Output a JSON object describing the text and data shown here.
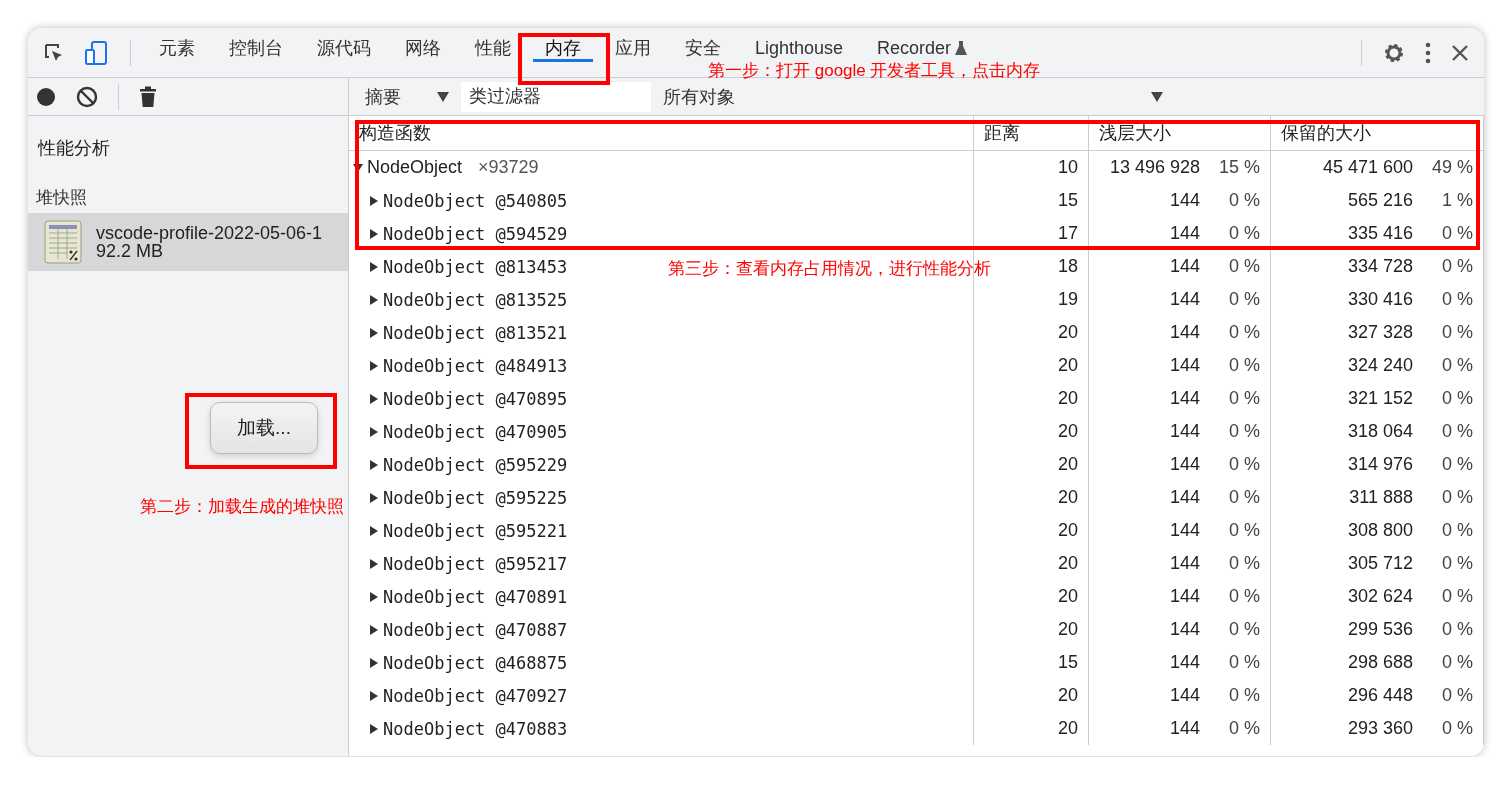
{
  "tabs": [
    {
      "label": "元素",
      "selected": false
    },
    {
      "label": "控制台",
      "selected": false
    },
    {
      "label": "源代码",
      "selected": false
    },
    {
      "label": "网络",
      "selected": false
    },
    {
      "label": "性能",
      "selected": false
    },
    {
      "label": "内存",
      "selected": true
    },
    {
      "label": "应用",
      "selected": false
    },
    {
      "label": "安全",
      "selected": false
    },
    {
      "label": "Lighthouse",
      "selected": false
    },
    {
      "label": "Recorder",
      "selected": false,
      "kind": "experimental"
    }
  ],
  "filter_bar": {
    "view": "摘要",
    "class_filter": {
      "placeholder": "类过滤器"
    },
    "scope": "所有对象"
  },
  "sidebar": {
    "title": "性能分析",
    "section": "堆快照",
    "profiles": [
      {
        "name": "vscode-profile-2022-05-06-1",
        "size": "92.2 MB",
        "selected": true
      }
    ],
    "load_button": "加载..."
  },
  "table": {
    "columns": [
      "构造函数",
      "距离",
      "浅层大小",
      "保留的大小"
    ],
    "rows": [
      {
        "name": "NodeObject",
        "count": "×93729",
        "distance": "10",
        "shallow": "13 496 928",
        "shallow_pct": "15 %",
        "retained": "45 471 600",
        "retained_pct": "49 %",
        "expanded": true,
        "children": [
          {
            "name": "NodeObject",
            "id": "@540805",
            "distance": "15",
            "shallow": "144",
            "shallow_pct": "0 %",
            "retained": "565 216",
            "retained_pct": "1 %",
            "expanded": false
          },
          {
            "name": "NodeObject",
            "id": "@594529",
            "distance": "17",
            "shallow": "144",
            "shallow_pct": "0 %",
            "retained": "335 416",
            "retained_pct": "0 %",
            "expanded": false
          },
          {
            "name": "NodeObject",
            "id": "@813453",
            "distance": "18",
            "shallow": "144",
            "shallow_pct": "0 %",
            "retained": "334 728",
            "retained_pct": "0 %",
            "expanded": false
          },
          {
            "name": "NodeObject",
            "id": "@813525",
            "distance": "19",
            "shallow": "144",
            "shallow_pct": "0 %",
            "retained": "330 416",
            "retained_pct": "0 %",
            "expanded": false
          },
          {
            "name": "NodeObject",
            "id": "@813521",
            "distance": "20",
            "shallow": "144",
            "shallow_pct": "0 %",
            "retained": "327 328",
            "retained_pct": "0 %",
            "expanded": false
          },
          {
            "name": "NodeObject",
            "id": "@484913",
            "distance": "20",
            "shallow": "144",
            "shallow_pct": "0 %",
            "retained": "324 240",
            "retained_pct": "0 %",
            "expanded": false
          },
          {
            "name": "NodeObject",
            "id": "@470895",
            "distance": "20",
            "shallow": "144",
            "shallow_pct": "0 %",
            "retained": "321 152",
            "retained_pct": "0 %",
            "expanded": false
          },
          {
            "name": "NodeObject",
            "id": "@470905",
            "distance": "20",
            "shallow": "144",
            "shallow_pct": "0 %",
            "retained": "318 064",
            "retained_pct": "0 %",
            "expanded": false
          },
          {
            "name": "NodeObject",
            "id": "@595229",
            "distance": "20",
            "shallow": "144",
            "shallow_pct": "0 %",
            "retained": "314 976",
            "retained_pct": "0 %",
            "expanded": false
          },
          {
            "name": "NodeObject",
            "id": "@595225",
            "distance": "20",
            "shallow": "144",
            "shallow_pct": "0 %",
            "retained": "311 888",
            "retained_pct": "0 %",
            "expanded": false
          },
          {
            "name": "NodeObject",
            "id": "@595221",
            "distance": "20",
            "shallow": "144",
            "shallow_pct": "0 %",
            "retained": "308 800",
            "retained_pct": "0 %",
            "expanded": false
          },
          {
            "name": "NodeObject",
            "id": "@595217",
            "distance": "20",
            "shallow": "144",
            "shallow_pct": "0 %",
            "retained": "305 712",
            "retained_pct": "0 %",
            "expanded": false
          },
          {
            "name": "NodeObject",
            "id": "@470891",
            "distance": "20",
            "shallow": "144",
            "shallow_pct": "0 %",
            "retained": "302 624",
            "retained_pct": "0 %",
            "expanded": false
          },
          {
            "name": "NodeObject",
            "id": "@470887",
            "distance": "20",
            "shallow": "144",
            "shallow_pct": "0 %",
            "retained": "299 536",
            "retained_pct": "0 %",
            "expanded": false
          },
          {
            "name": "NodeObject",
            "id": "@468875",
            "distance": "15",
            "shallow": "144",
            "shallow_pct": "0 %",
            "retained": "298 688",
            "retained_pct": "0 %",
            "expanded": false
          },
          {
            "name": "NodeObject",
            "id": "@470927",
            "distance": "20",
            "shallow": "144",
            "shallow_pct": "0 %",
            "retained": "296 448",
            "retained_pct": "0 %",
            "expanded": false
          },
          {
            "name": "NodeObject",
            "id": "@470883",
            "distance": "20",
            "shallow": "144",
            "shallow_pct": "0 %",
            "retained": "293 360",
            "retained_pct": "0 %",
            "expanded": false
          }
        ]
      }
    ]
  },
  "annotations": [
    {
      "kind": "tab",
      "text": "第一步：打开 google 开发者工具，点击内存"
    },
    {
      "kind": "load",
      "text": "第二步：加载生成的堆快照"
    },
    {
      "kind": "table",
      "text": "第三步：查看内存占用情况，进行性能分析"
    }
  ]
}
